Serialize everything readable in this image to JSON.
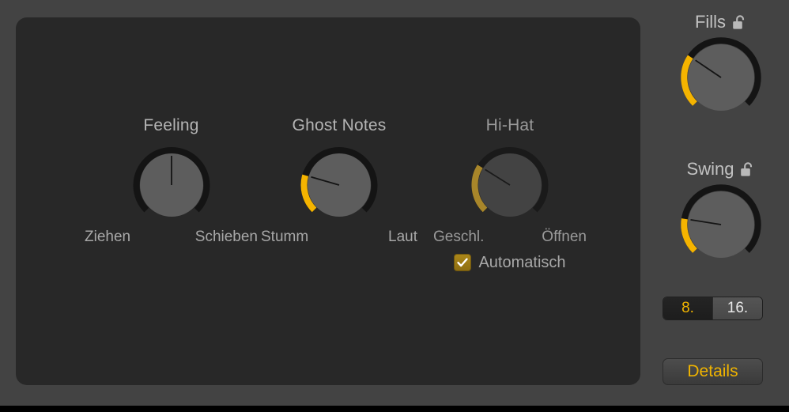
{
  "window": {
    "background_color": "#434343",
    "panel_color": "#282828",
    "accent_color": "#f5b400",
    "accent_dim_color": "#a8862a"
  },
  "main_panel": {
    "knobs": [
      {
        "id": "feeling",
        "title": "Feeling",
        "left_label": "Ziehen",
        "right_label": "Schieben",
        "value_deg": 0,
        "fill_start_deg": 0,
        "enabled": true
      },
      {
        "id": "ghost_notes",
        "title": "Ghost Notes",
        "left_label": "Stumm",
        "right_label": "Laut",
        "value_deg": -74,
        "fill_start_deg": -135,
        "enabled": true
      },
      {
        "id": "hi_hat",
        "title": "Hi-Hat",
        "left_label": "Geschl.",
        "right_label": "Öffnen",
        "value_deg": -58,
        "fill_start_deg": -135,
        "enabled": false
      }
    ],
    "automatic_checkbox": {
      "label": "Automatisch",
      "checked": true
    }
  },
  "right_panel": {
    "knobs": [
      {
        "id": "fills",
        "title": "Fills",
        "lock_icon": "unlocked-padlock-icon",
        "locked": false,
        "value_deg": -56,
        "fill_start_deg": -135
      },
      {
        "id": "swing",
        "title": "Swing",
        "lock_icon": "unlocked-padlock-icon",
        "locked": false,
        "value_deg": -81,
        "fill_start_deg": -135
      }
    ],
    "segmented_control": {
      "options": [
        {
          "label": "8.",
          "selected": true
        },
        {
          "label": "16.",
          "selected": false
        }
      ]
    },
    "details_button": {
      "label": "Details"
    }
  }
}
